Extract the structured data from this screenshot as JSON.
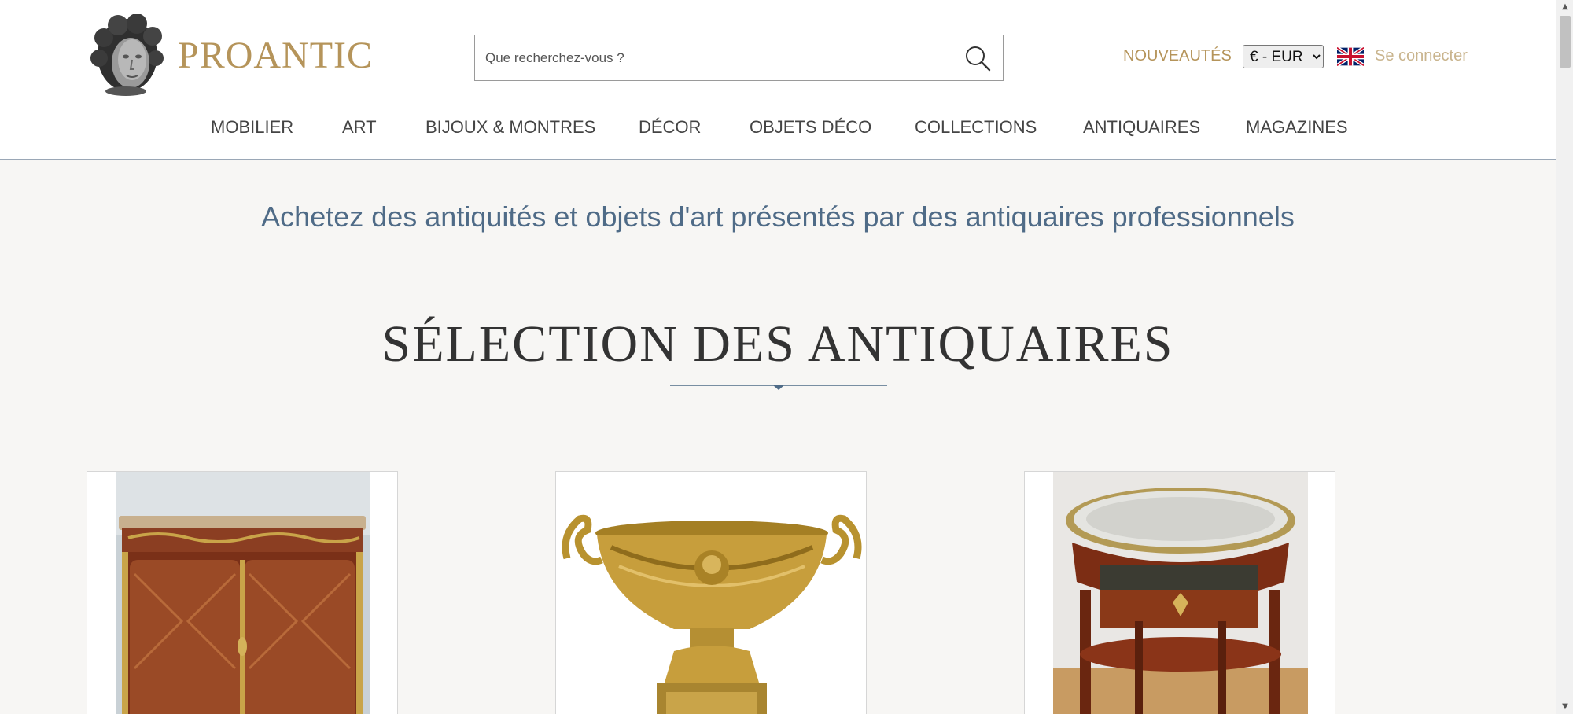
{
  "header": {
    "logo_text": "PROANTIC",
    "search_placeholder": "Que recherchez-vous ?",
    "nouveautes": "NOUVEAUTÉS",
    "currency": {
      "selected": "€ - EUR",
      "options": [
        "€ - EUR"
      ]
    },
    "login": "Se connecter"
  },
  "nav": {
    "items": [
      {
        "label": "MOBILIER"
      },
      {
        "label": "ART"
      },
      {
        "label": "BIJOUX & MONTRES"
      },
      {
        "label": "DÉCOR"
      },
      {
        "label": "OBJETS DÉCO"
      },
      {
        "label": "COLLECTIONS"
      },
      {
        "label": "ANTIQUAIRES"
      },
      {
        "label": "MAGAZINES"
      }
    ]
  },
  "main": {
    "tagline": "Achetez des antiquités et objets d'art présentés par des antiquaires professionnels",
    "section_title": "SÉLECTION DES ANTIQUAIRES"
  },
  "colors": {
    "brand_gold": "#b5945a",
    "tagline_blue": "#4f6b87",
    "login_gold": "#c9b48d",
    "background": "#f7f6f4"
  },
  "icons": {
    "search": "search-icon",
    "flag": "uk-flag-icon",
    "logo": "cherub-head-logo"
  }
}
